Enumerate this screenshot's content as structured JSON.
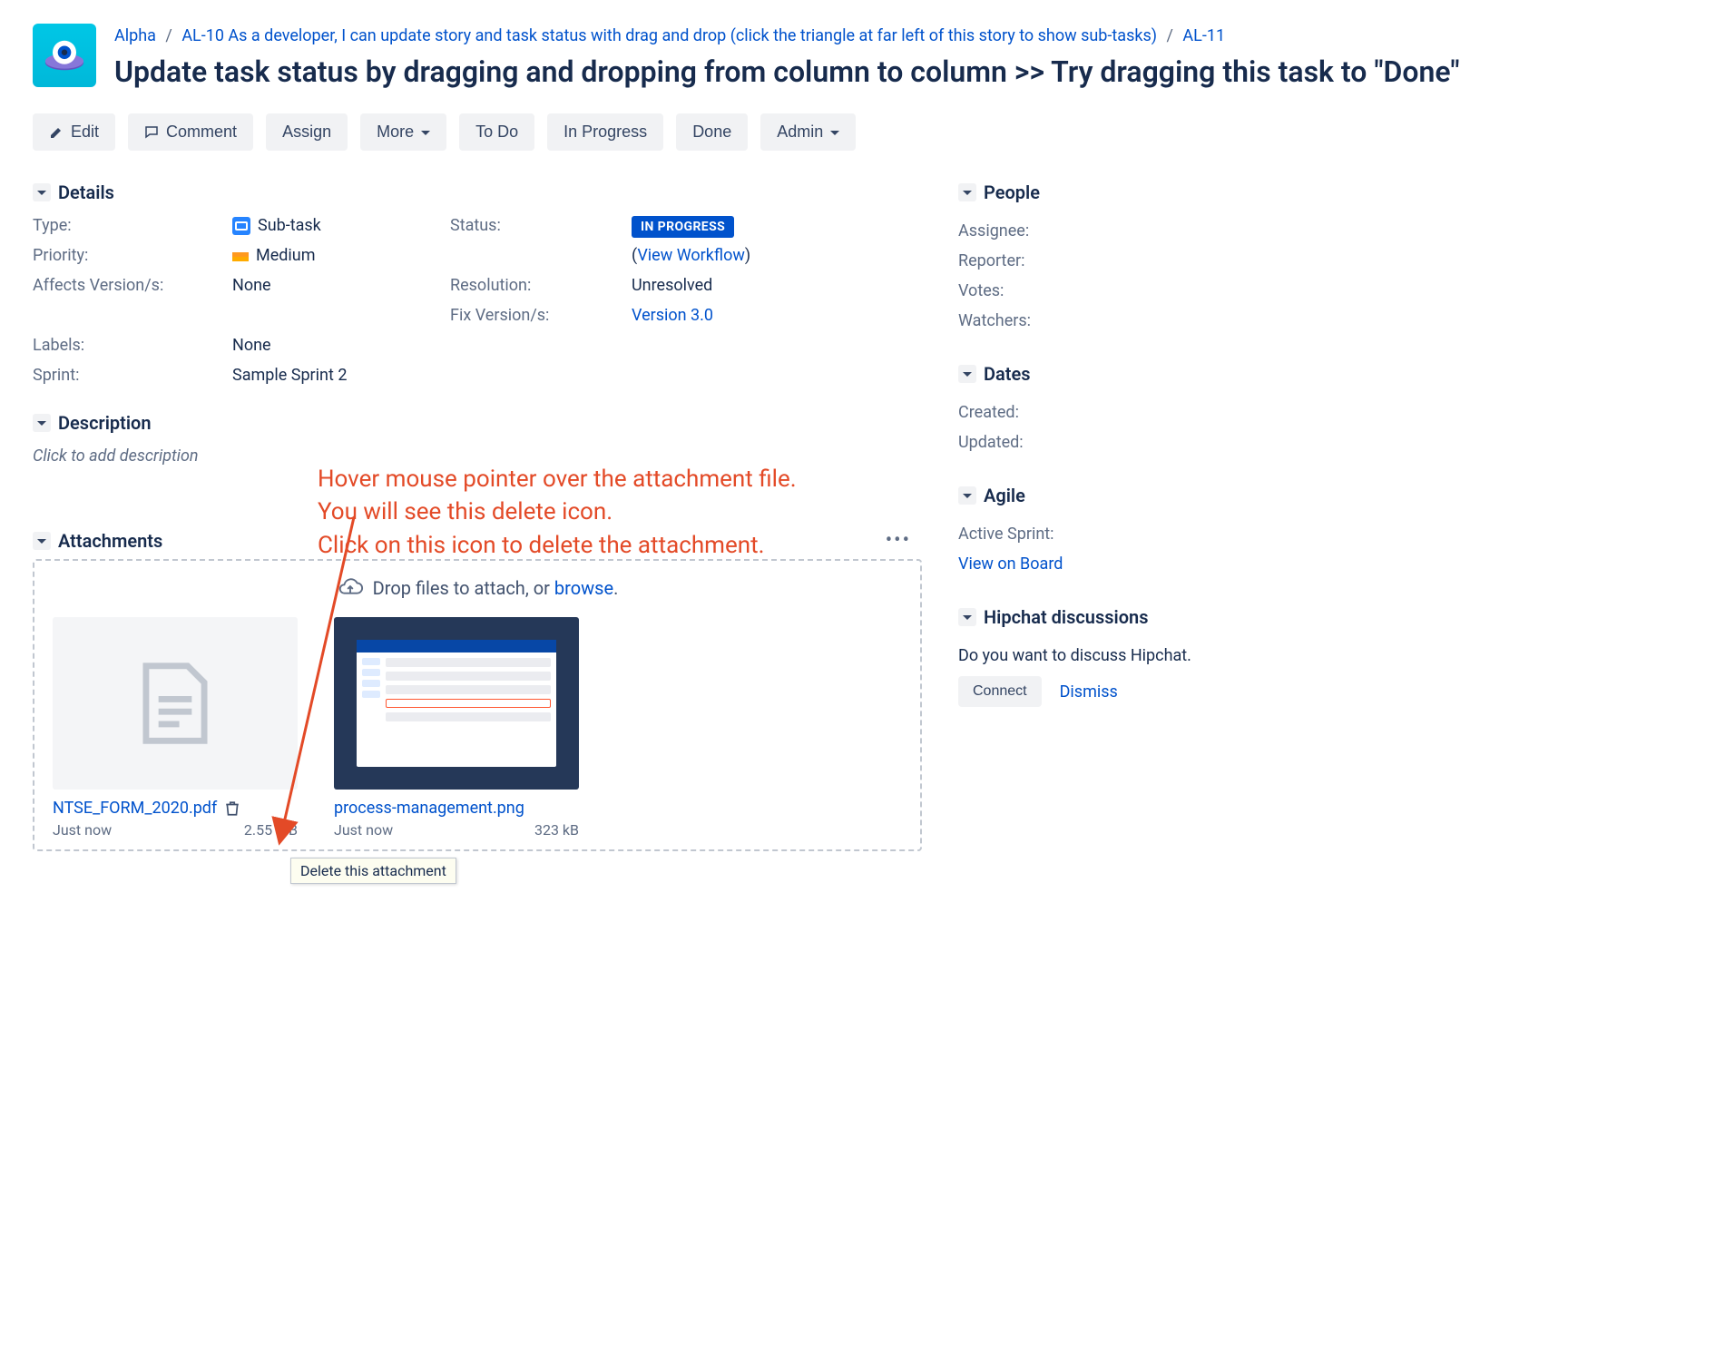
{
  "breadcrumb": {
    "project": "Alpha",
    "parent": "AL-10 As a developer, I can update story and task status with drag and drop (click the triangle at far left of this story to show sub-tasks)",
    "issue": "AL-11"
  },
  "title": "Update task status by dragging and dropping from column to column >> Try dragging this task to \"Done\"",
  "actions": {
    "edit": "Edit",
    "comment": "Comment",
    "assign": "Assign",
    "more": "More",
    "todo": "To Do",
    "inprogress": "In Progress",
    "done": "Done",
    "admin": "Admin"
  },
  "sections": {
    "details": "Details",
    "description": "Description",
    "attachments": "Attachments",
    "people": "People",
    "dates": "Dates",
    "agile": "Agile",
    "hipchat": "Hipchat discussions"
  },
  "details": {
    "typeLabel": "Type:",
    "typeValue": "Sub-task",
    "priorityLabel": "Priority:",
    "priorityValue": "Medium",
    "affectsLabel": "Affects Version/s:",
    "affectsValue": "None",
    "labelsLabel": "Labels:",
    "labelsValue": "None",
    "sprintLabel": "Sprint:",
    "sprintValue": "Sample Sprint 2",
    "statusLabel": "Status:",
    "statusValue": "IN PROGRESS",
    "viewWorkflow": "View Workflow",
    "resolutionLabel": "Resolution:",
    "resolutionValue": "Unresolved",
    "fixLabel": "Fix Version/s:",
    "fixValue": "Version 3.0"
  },
  "description": {
    "placeholder": "Click to add description"
  },
  "annotation": {
    "l1": "Hover mouse pointer over the attachment file.",
    "l2": "You will see this delete icon.",
    "l3": "Click on this icon to delete the attachment."
  },
  "attachments": {
    "dropHint": "Drop files to attach, or ",
    "browse": "browse",
    "items": [
      {
        "name": "NTSE_FORM_2020.pdf",
        "time": "Just now",
        "size": "2.55 MB"
      },
      {
        "name": "process-management.png",
        "time": "Just now",
        "size": "323 kB"
      }
    ],
    "tooltip": "Delete this attachment"
  },
  "people": {
    "assignee": "Assignee:",
    "reporter": "Reporter:",
    "votes": "Votes:",
    "watchers": "Watchers:"
  },
  "dates": {
    "created": "Created:",
    "updated": "Updated:"
  },
  "agile": {
    "activeSprint": "Active Sprint:",
    "viewOnBoard": "View on Board"
  },
  "hipchat": {
    "text": "Do you want to discuss Hipchat.",
    "connect": "Connect",
    "dismiss": "Dismiss"
  }
}
